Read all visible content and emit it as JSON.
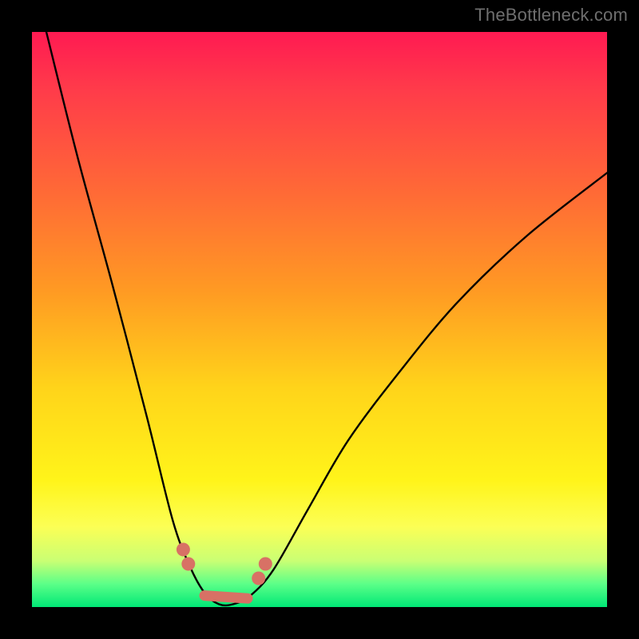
{
  "watermark": "TheBottleneck.com",
  "colors": {
    "page_bg": "#000000",
    "curve": "#000000",
    "marker": "#d87165",
    "gradient_top": "#ff1a52",
    "gradient_mid": "#fff41a",
    "gradient_bottom": "#00e876"
  },
  "chart_data": {
    "type": "line",
    "title": "",
    "xlabel": "",
    "ylabel": "",
    "xlim": [
      0,
      1
    ],
    "ylim": [
      0,
      1
    ],
    "notes": "V-shaped bottleneck curve on a red–yellow–green vertical gradient. Axis ticks and units are not visible in the image, so x/y are normalized 0–1 (left→right, bottom→top). Curve values are estimated from pixel positions.",
    "background_gradient_stops": [
      {
        "pos": 0.0,
        "color": "#ff1a52"
      },
      {
        "pos": 0.1,
        "color": "#ff3b4a"
      },
      {
        "pos": 0.28,
        "color": "#ff6a36"
      },
      {
        "pos": 0.45,
        "color": "#ff9a23"
      },
      {
        "pos": 0.62,
        "color": "#ffd41a"
      },
      {
        "pos": 0.78,
        "color": "#fff41a"
      },
      {
        "pos": 0.86,
        "color": "#fcff55"
      },
      {
        "pos": 0.92,
        "color": "#c9ff74"
      },
      {
        "pos": 0.96,
        "color": "#5bff88"
      },
      {
        "pos": 1.0,
        "color": "#00e876"
      }
    ],
    "series": [
      {
        "name": "bottleneck-curve",
        "x": [
          0.025,
          0.08,
          0.14,
          0.2,
          0.245,
          0.275,
          0.3,
          0.325,
          0.35,
          0.38,
          0.42,
          0.48,
          0.55,
          0.64,
          0.74,
          0.86,
          1.0
        ],
        "y": [
          1.0,
          0.78,
          0.56,
          0.33,
          0.15,
          0.07,
          0.025,
          0.005,
          0.005,
          0.02,
          0.065,
          0.17,
          0.29,
          0.41,
          0.53,
          0.645,
          0.755
        ]
      }
    ],
    "markers": [
      {
        "name": "left-upper-dot",
        "x": 0.263,
        "y": 0.1
      },
      {
        "name": "left-lower-dot",
        "x": 0.272,
        "y": 0.075
      },
      {
        "name": "right-lower-dot",
        "x": 0.394,
        "y": 0.05
      },
      {
        "name": "right-upper-dot",
        "x": 0.406,
        "y": 0.075
      },
      {
        "name": "valley-floor-left",
        "x": 0.3,
        "y": 0.02
      },
      {
        "name": "valley-floor-right",
        "x": 0.375,
        "y": 0.015
      }
    ]
  }
}
